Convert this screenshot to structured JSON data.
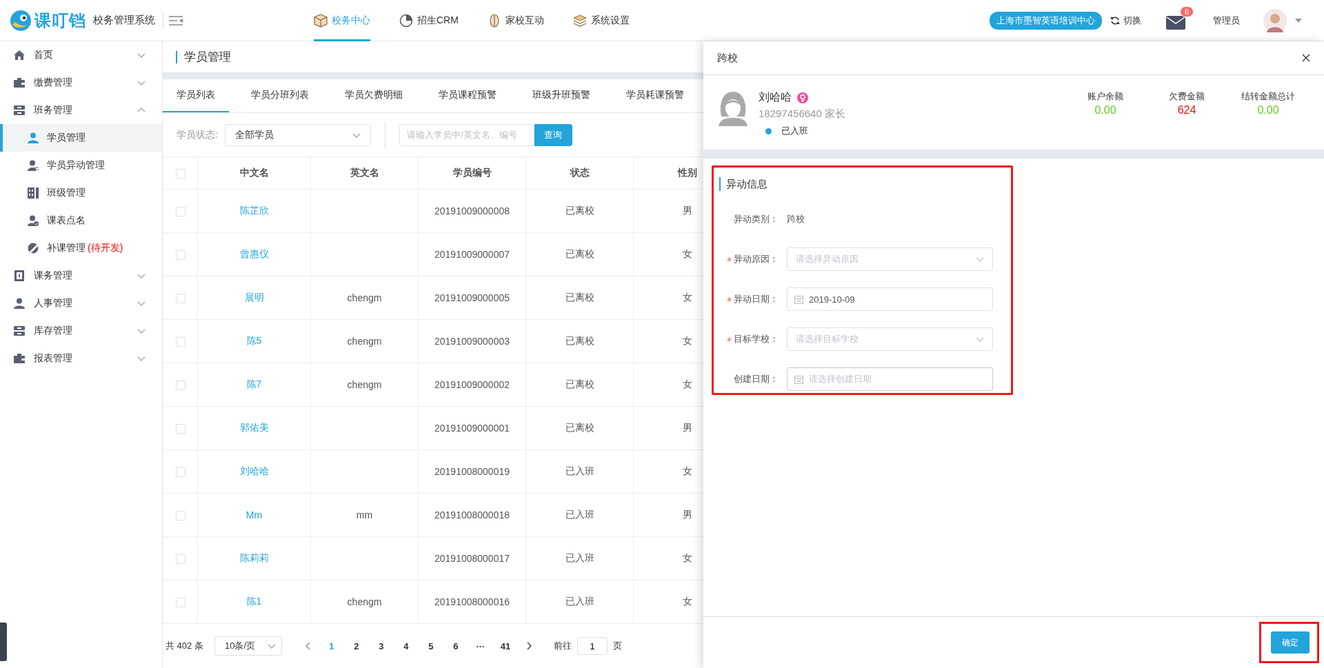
{
  "header": {
    "logo_text": "课叮铛",
    "system_name": "校务管理系统",
    "nav": [
      {
        "label": "校务中心",
        "selected": true
      },
      {
        "label": "招生CRM",
        "selected": false
      },
      {
        "label": "家校互动",
        "selected": false
      },
      {
        "label": "系统设置",
        "selected": false
      }
    ],
    "campus": "上海市墨智英语培训中心",
    "switch_label": "切换",
    "mail_count": "6",
    "user": "管理员"
  },
  "sidebar": {
    "items": [
      {
        "label": "首页",
        "expanded": false
      },
      {
        "label": "缴费管理",
        "expanded": false
      },
      {
        "label": "班务管理",
        "expanded": true,
        "children": [
          {
            "label": "学员管理",
            "selected": true
          },
          {
            "label": "学员异动管理",
            "selected": false
          },
          {
            "label": "班级管理",
            "selected": false
          },
          {
            "label": "课表点名",
            "selected": false
          },
          {
            "label": "补课管理",
            "note": "(待开发)",
            "selected": false
          }
        ]
      },
      {
        "label": "课务管理",
        "expanded": false
      },
      {
        "label": "人事管理",
        "expanded": false
      },
      {
        "label": "库存管理",
        "expanded": false
      },
      {
        "label": "报表管理",
        "expanded": false
      }
    ]
  },
  "page": {
    "title": "学员管理",
    "tabs": [
      {
        "label": "学员列表",
        "selected": true
      },
      {
        "label": "学员分班列表",
        "selected": false
      },
      {
        "label": "学员欠费明细",
        "selected": false
      },
      {
        "label": "学员课程预警",
        "selected": false
      },
      {
        "label": "班级升班预警",
        "selected": false
      },
      {
        "label": "学员耗课预警",
        "selected": false
      }
    ],
    "filter": {
      "status_label": "学员状态:",
      "status_value": "全部学员",
      "search_placeholder": "请输入学员中/英文名、编号",
      "search_button": "查询"
    },
    "table": {
      "header_checked": false,
      "columns": [
        "中文名",
        "英文名",
        "学员编号",
        "状态",
        "性别"
      ],
      "rows": [
        {
          "checked": false,
          "name": "陈芷欣",
          "number": "20191009000008",
          "status": "已离校",
          "gender": "男"
        },
        {
          "checked": false,
          "name": "曾惠仪",
          "number": "20191009000007",
          "status": "已离校",
          "gender": "女"
        },
        {
          "checked": false,
          "name": "晨明",
          "english": "chengm",
          "number": "20191009000005",
          "status": "已离校",
          "gender": "女"
        },
        {
          "checked": false,
          "name": "陈5",
          "english": "chengm",
          "number": "20191009000003",
          "status": "已离校",
          "gender": "女"
        },
        {
          "checked": false,
          "name": "陈7",
          "english": "chengm",
          "number": "20191009000002",
          "status": "已离校",
          "gender": "女"
        },
        {
          "checked": false,
          "name": "郭佑美",
          "number": "20191009000001",
          "status": "已离校",
          "gender": "男"
        },
        {
          "checked": false,
          "name": "刘哈哈",
          "number": "20191008000019",
          "status": "已入班",
          "gender": "女"
        },
        {
          "checked": false,
          "name": "Mm",
          "english": "mm",
          "number": "20191008000018",
          "status": "已入班",
          "gender": "男"
        },
        {
          "checked": false,
          "name": "陈莉莉",
          "number": "20191008000017",
          "status": "已入班",
          "gender": "女"
        },
        {
          "checked": false,
          "name": "陈1",
          "english": "chengm",
          "number": "20191008000016",
          "status": "已入班",
          "gender": "女"
        }
      ]
    },
    "pagination": {
      "total": "共 402 条",
      "page_size": "10条/页",
      "pages": [
        {
          "kind": "page",
          "label": "1",
          "selected": true
        },
        {
          "kind": "page",
          "label": "2",
          "selected": false
        },
        {
          "kind": "page",
          "label": "3",
          "selected": false
        },
        {
          "kind": "page",
          "label": "4",
          "selected": false
        },
        {
          "kind": "page",
          "label": "5",
          "selected": false
        },
        {
          "kind": "page",
          "label": "6",
          "selected": false
        },
        {
          "kind": "ellipsis",
          "label": "···"
        },
        {
          "kind": "page",
          "label": "41",
          "selected": false
        }
      ],
      "goto_label": "前往",
      "goto_value": "1",
      "goto_suffix": "页"
    }
  },
  "drawer": {
    "title": "跨校",
    "student": {
      "name": "刘哈哈",
      "phone": "18297456640 家长",
      "status": "已入班"
    },
    "stats": [
      {
        "label": "账户余额",
        "value": "0.00",
        "color": "#66cc22"
      },
      {
        "label": "欠费金额",
        "value": "624",
        "color": "#ee1111"
      },
      {
        "label": "结转金额总计",
        "value": "0.00",
        "color": "#66cc22"
      }
    ],
    "section": {
      "title": "异动信息",
      "highlighted": true,
      "fields": [
        {
          "kind": "text",
          "label": "异动类别：",
          "required": false,
          "value": "跨校"
        },
        {
          "kind": "select",
          "label": "异动原因：",
          "required": true,
          "placeholder": "请选择异动原因"
        },
        {
          "kind": "date",
          "label": "异动日期：",
          "required": true,
          "value": "2019-10-09"
        },
        {
          "kind": "select",
          "label": "目标学校：",
          "required": true,
          "placeholder": "请选择目标学校"
        },
        {
          "kind": "date",
          "label": "创建日期：",
          "required": false,
          "placeholder": "请选择创建日期"
        }
      ]
    },
    "confirm": {
      "label": "确定",
      "highlighted": true
    }
  }
}
